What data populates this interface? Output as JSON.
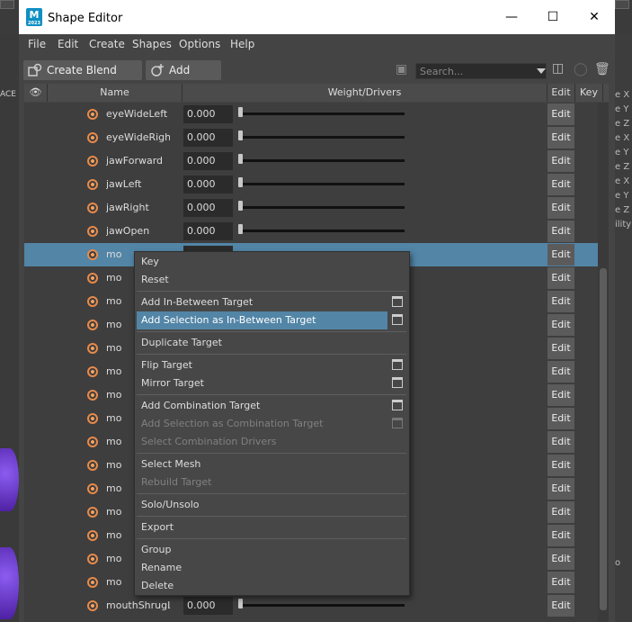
{
  "window": {
    "title": "Shape Editor",
    "icon_name": "maya-app-icon",
    "icon_text": "M",
    "icon_subtext": "2023"
  },
  "background": {
    "left_label": "ACE",
    "right_labels": [
      "e X",
      "e Y",
      "e Z",
      "e X",
      "e Y",
      "e Z",
      "e X",
      "e Y",
      "e Z",
      "ility"
    ],
    "right_lower": "o"
  },
  "menubar": [
    "File",
    "Edit",
    "Create",
    "Shapes",
    "Options",
    "Help"
  ],
  "toolbar": {
    "create_blend_shape": "Create Blend Shape",
    "add_target": "Add Target",
    "search_placeholder": "Search..."
  },
  "columns": {
    "name": "Name",
    "weight": "Weight/Drivers",
    "edit": "Edit",
    "key": "Key"
  },
  "rows": [
    {
      "name": "eyeWideLeft",
      "value": "0.000",
      "edit": "Edit"
    },
    {
      "name": "eyeWideRight",
      "value": "0.000",
      "edit": "Edit"
    },
    {
      "name": "jawForward",
      "value": "0.000",
      "edit": "Edit"
    },
    {
      "name": "jawLeft",
      "value": "0.000",
      "edit": "Edit"
    },
    {
      "name": "jawRight",
      "value": "0.000",
      "edit": "Edit"
    },
    {
      "name": "jawOpen",
      "value": "0.000",
      "edit": "Edit"
    },
    {
      "name": "mo",
      "value": "",
      "edit": "Edit",
      "selected": true
    },
    {
      "name": "mo",
      "value": "",
      "edit": "Edit"
    },
    {
      "name": "mo",
      "value": "",
      "edit": "Edit"
    },
    {
      "name": "mo",
      "value": "",
      "edit": "Edit"
    },
    {
      "name": "mo",
      "value": "",
      "edit": "Edit"
    },
    {
      "name": "mo",
      "value": "",
      "edit": "Edit"
    },
    {
      "name": "mo",
      "value": "",
      "edit": "Edit"
    },
    {
      "name": "mo",
      "value": "",
      "edit": "Edit"
    },
    {
      "name": "mo",
      "value": "",
      "edit": "Edit"
    },
    {
      "name": "mo",
      "value": "",
      "edit": "Edit"
    },
    {
      "name": "mo",
      "value": "",
      "edit": "Edit"
    },
    {
      "name": "mo",
      "value": "",
      "edit": "Edit"
    },
    {
      "name": "mo",
      "value": "",
      "edit": "Edit"
    },
    {
      "name": "mo",
      "value": "",
      "edit": "Edit"
    },
    {
      "name": "mo",
      "value": "",
      "edit": "Edit"
    },
    {
      "name": "mouthShrugLow",
      "value": "0.000",
      "edit": "Edit"
    }
  ],
  "context_menu": {
    "key": "Key",
    "reset": "Reset",
    "add_inbetween": "Add In-Between Target",
    "add_selection_inbetween": "Add Selection as In-Between Target",
    "duplicate": "Duplicate Target",
    "flip": "Flip Target",
    "mirror": "Mirror Target",
    "add_combination": "Add Combination Target",
    "add_selection_combination": "Add Selection as Combination Target",
    "select_combination_drivers": "Select Combination Drivers",
    "select_mesh": "Select Mesh",
    "rebuild": "Rebuild Target",
    "solo": "Solo/Unsolo",
    "export": "Export",
    "group": "Group",
    "rename": "Rename",
    "delete": "Delete"
  },
  "colors": {
    "selection": "#5285a6",
    "target_icon": "#e88a4a",
    "panel": "#444444"
  }
}
